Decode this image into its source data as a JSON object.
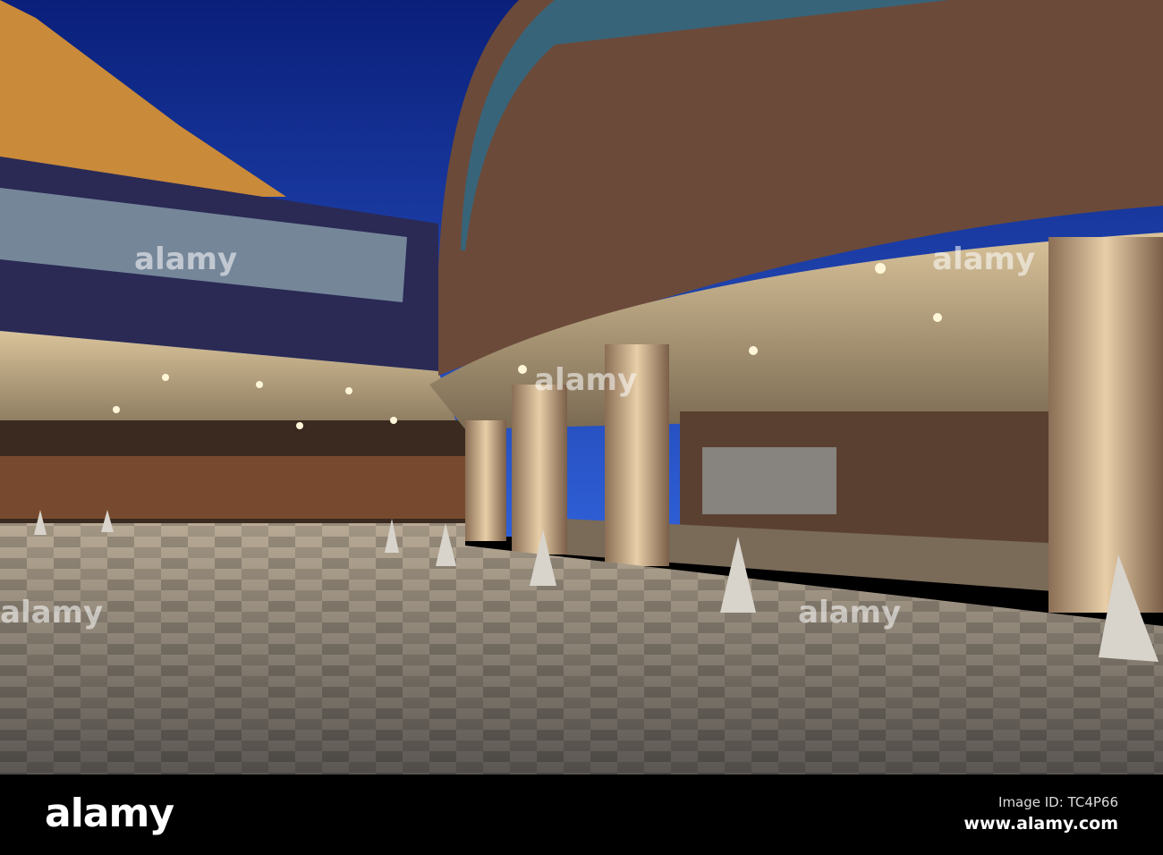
{
  "photo": {
    "subject": "modern building entrance with curved facade, columns and plaza at dusk",
    "colors": {
      "sky_top": "#0b2a8a",
      "sky_bottom": "#2a55d0",
      "facade": "#6b4a3a",
      "floor": "#8a8580",
      "light": "#ffe7b0"
    }
  },
  "watermark": {
    "text": "alamy"
  },
  "footer": {
    "logo": "alamy",
    "image_id": "Image ID: TC4P66",
    "site": "www.alamy.com"
  }
}
